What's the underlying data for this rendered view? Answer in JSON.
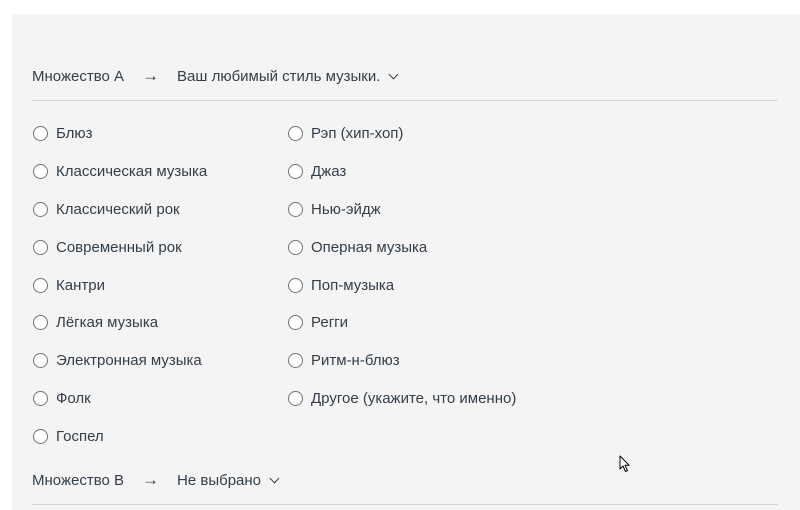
{
  "set_a": {
    "label": "Множество A",
    "arrow": "→",
    "selected": "Ваш любимый стиль музыки."
  },
  "set_b": {
    "label": "Множество B",
    "arrow": "→",
    "selected": "Не выбрано"
  },
  "options_left": [
    "Блюз",
    "Классическая музыка",
    "Классический рок",
    "Современный рок",
    "Кантри",
    "Лёгкая музыка",
    "Электронная музыка",
    "Фолк",
    "Госпел"
  ],
  "options_right": [
    "Рэп (хип-хоп)",
    "Джаз",
    "Нью-эйдж",
    "Оперная музыка",
    "Поп-музыка",
    "Регги",
    "Ритм-н-блюз",
    "Другое (укажите, что именно)"
  ]
}
